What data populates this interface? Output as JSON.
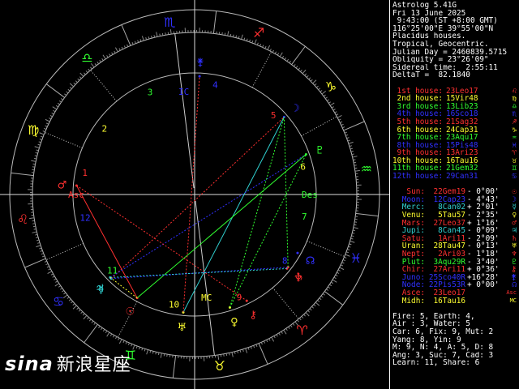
{
  "header": {
    "lines": [
      "Astrolog 5.41G",
      "Fri 13 June 2025",
      " 9:43:00 (ST +8:00 GMT)",
      "116°25'00\"E 39°55'00\"N",
      "Placidus houses.",
      "Tropical, Geocentric.",
      "Julian Day = 2460839.5715",
      "Obliquity = 23°26'09\"",
      "Sidereal time:  2:55:11",
      "DeltaT =  82.1840"
    ]
  },
  "houses": [
    {
      "label": "1st house:",
      "value": "23Leo17",
      "color": "#ff3030",
      "glyph": "♌"
    },
    {
      "label": "2nd house:",
      "value": "15Vir48",
      "color": "#ffff30",
      "glyph": "♍"
    },
    {
      "label": "3rd house:",
      "value": "13Lib23",
      "color": "#30ff30",
      "glyph": "♎"
    },
    {
      "label": "4th house:",
      "value": "16Sco18",
      "color": "#3030ff",
      "glyph": "♏"
    },
    {
      "label": "5th house:",
      "value": "21Sag32",
      "color": "#ff3030",
      "glyph": "♐"
    },
    {
      "label": "6th house:",
      "value": "24Cap31",
      "color": "#ffff30",
      "glyph": "♑"
    },
    {
      "label": "7th house:",
      "value": "23Aqu17",
      "color": "#30ff30",
      "glyph": "♒"
    },
    {
      "label": "8th house:",
      "value": "15Pis48",
      "color": "#3030ff",
      "glyph": "♓"
    },
    {
      "label": "9th house:",
      "value": "13Ari23",
      "color": "#ff3030",
      "glyph": "♈"
    },
    {
      "label": "10th house:",
      "value": "16Tau16",
      "color": "#ffff30",
      "glyph": "♉"
    },
    {
      "label": "11th house:",
      "value": "21Gem32",
      "color": "#30ff30",
      "glyph": "♊"
    },
    {
      "label": "12th house:",
      "value": "29Can31",
      "color": "#3030ff",
      "glyph": "♋"
    }
  ],
  "planets": [
    {
      "name": "Sun:",
      "pos": "22Gem19",
      "lat": "- 0°00'",
      "color": "#ff3030",
      "glyph": "☉"
    },
    {
      "name": "Moon:",
      "pos": "12Cap23",
      "lat": "- 4°43'",
      "color": "#3030ff",
      "glyph": "☽"
    },
    {
      "name": "Merc:",
      "pos": "8Can02",
      "lat": "+ 2°01'",
      "color": "#30d0d0",
      "glyph": "☿"
    },
    {
      "name": "Venu:",
      "pos": "5Tau57",
      "lat": "- 2°35'",
      "color": "#ffff30",
      "glyph": "♀"
    },
    {
      "name": "Mars:",
      "pos": "27Leo37",
      "lat": "+ 1°16'",
      "color": "#ff3030",
      "glyph": "♂"
    },
    {
      "name": "Jupi:",
      "pos": "8Can45",
      "lat": "- 0°09'",
      "color": "#30d0d0",
      "glyph": "♃"
    },
    {
      "name": "Satu:",
      "pos": "1Ari11",
      "lat": "- 2°09'",
      "color": "#ff3030",
      "glyph": "♄"
    },
    {
      "name": "Uran:",
      "pos": "28Tau47",
      "lat": "- 0°13'",
      "color": "#ffff30",
      "glyph": "♅"
    },
    {
      "name": "Nept:",
      "pos": "2Ari03",
      "lat": "- 1°18'",
      "color": "#ff3030",
      "glyph": "♆"
    },
    {
      "name": "Plut:",
      "pos": "3Aqu29R",
      "lat": "- 3°40'",
      "color": "#30ff30",
      "glyph": "♇"
    },
    {
      "name": "Chir:",
      "pos": "27Ari11",
      "lat": "+ 0°36'",
      "color": "#ff3030",
      "glyph": "⚷"
    },
    {
      "name": "Juno:",
      "pos": "25Sco40R",
      "lat": "+16°28'",
      "color": "#3030ff",
      "glyph": "⚵"
    },
    {
      "name": "Node:",
      "pos": "22Pis53R",
      "lat": "+ 0°00'",
      "color": "#3030ff",
      "glyph": "☊"
    },
    {
      "name": "Asce:",
      "pos": "23Leo17",
      "lat": "",
      "color": "#ff3030",
      "glyph": "Asc"
    },
    {
      "name": "Midh:",
      "pos": "16Tau16",
      "lat": "",
      "color": "#ffff30",
      "glyph": "MC"
    }
  ],
  "elements": [
    "Fire: 5, Earth: 4,",
    "Air : 3, Water: 5",
    "Car: 6, Fix: 9, Mut: 2",
    "Yang: 8, Yin: 9",
    "M: 9, N: 4, A: 5, D: 8",
    "Ang: 3, Suc: 7, Cad: 3",
    "Learn: 11, Share: 6"
  ],
  "wheel": {
    "asc_label": "Asc",
    "des_label": "Des",
    "mc_label": "MC",
    "ic_label": "IC",
    "house_numbers": [
      "1",
      "2",
      "3",
      "4",
      "5",
      "6",
      "7",
      "8",
      "9",
      "10",
      "11",
      "12"
    ]
  },
  "watermark": {
    "brand": "sina",
    "text": "新浪星座"
  }
}
